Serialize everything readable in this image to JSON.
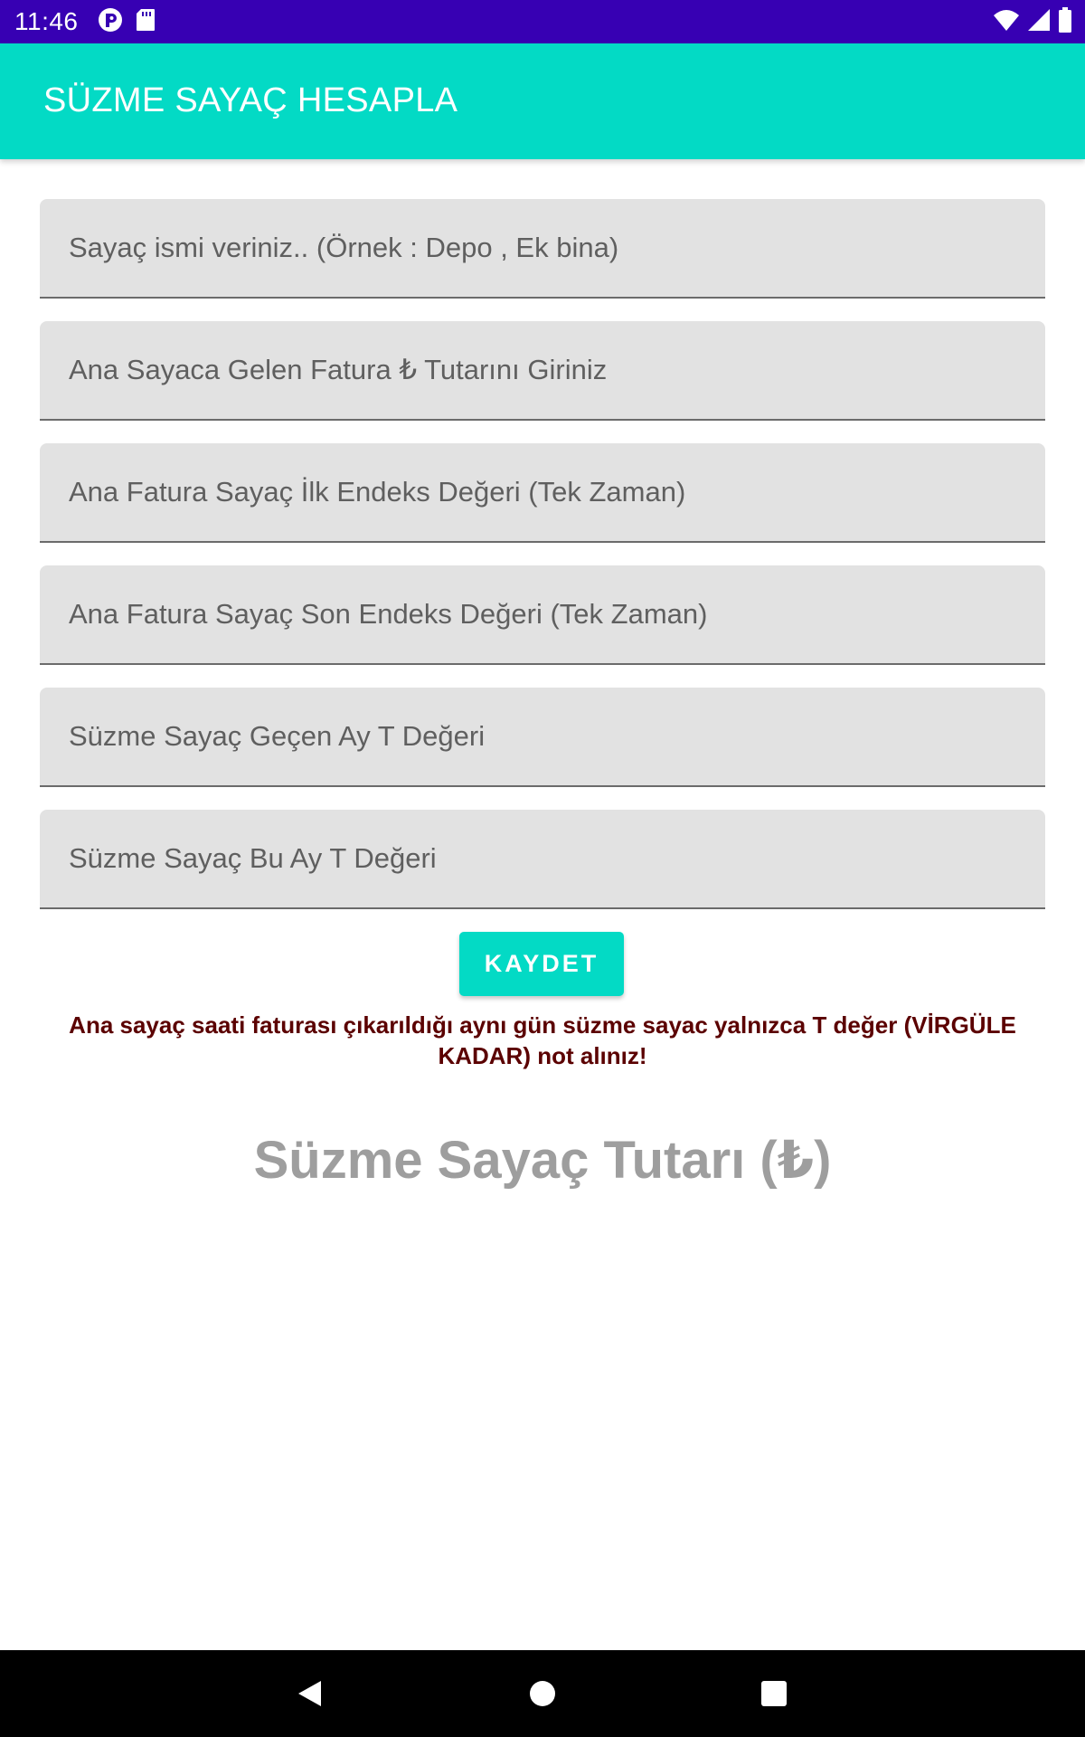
{
  "status_bar": {
    "time": "11:46",
    "background": "#3700b3",
    "left_icons": [
      "media-notification-icon",
      "sd-card-icon"
    ],
    "right_icons": [
      "wifi-icon",
      "signal-icon",
      "battery-icon"
    ]
  },
  "app_bar": {
    "title": "SÜZME SAYAÇ HESAPLA",
    "background": "#03dac5"
  },
  "form": {
    "fields": [
      {
        "placeholder": "Sayaç ismi veriniz.. (Örnek : Depo , Ek bina)",
        "value": ""
      },
      {
        "placeholder": "Ana Sayaca Gelen Fatura ₺ Tutarını Giriniz",
        "value": ""
      },
      {
        "placeholder": "Ana Fatura Sayaç İlk Endeks Değeri (Tek Zaman)",
        "value": ""
      },
      {
        "placeholder": "Ana Fatura Sayaç Son Endeks Değeri (Tek Zaman)",
        "value": ""
      },
      {
        "placeholder": "Süzme Sayaç Geçen Ay T Değeri",
        "value": ""
      },
      {
        "placeholder": "Süzme Sayaç Bu Ay T Değeri",
        "value": ""
      }
    ],
    "save_label": "KAYDET"
  },
  "warning": "Ana sayaç saati faturası çıkarıldığı aynı gün süzme sayac yalnızca T değer (VİRGÜLE KADAR) not alınız!",
  "result_label": "Süzme Sayaç Tutarı (₺)",
  "nav_bar": {
    "icons": [
      "back-icon",
      "home-icon",
      "recents-icon"
    ]
  },
  "colors": {
    "accent": "#03dac5",
    "status_bar": "#3700b3",
    "warning_text": "#5b0000",
    "result_text": "#9e9e9e",
    "field_background": "#e2e2e2"
  }
}
